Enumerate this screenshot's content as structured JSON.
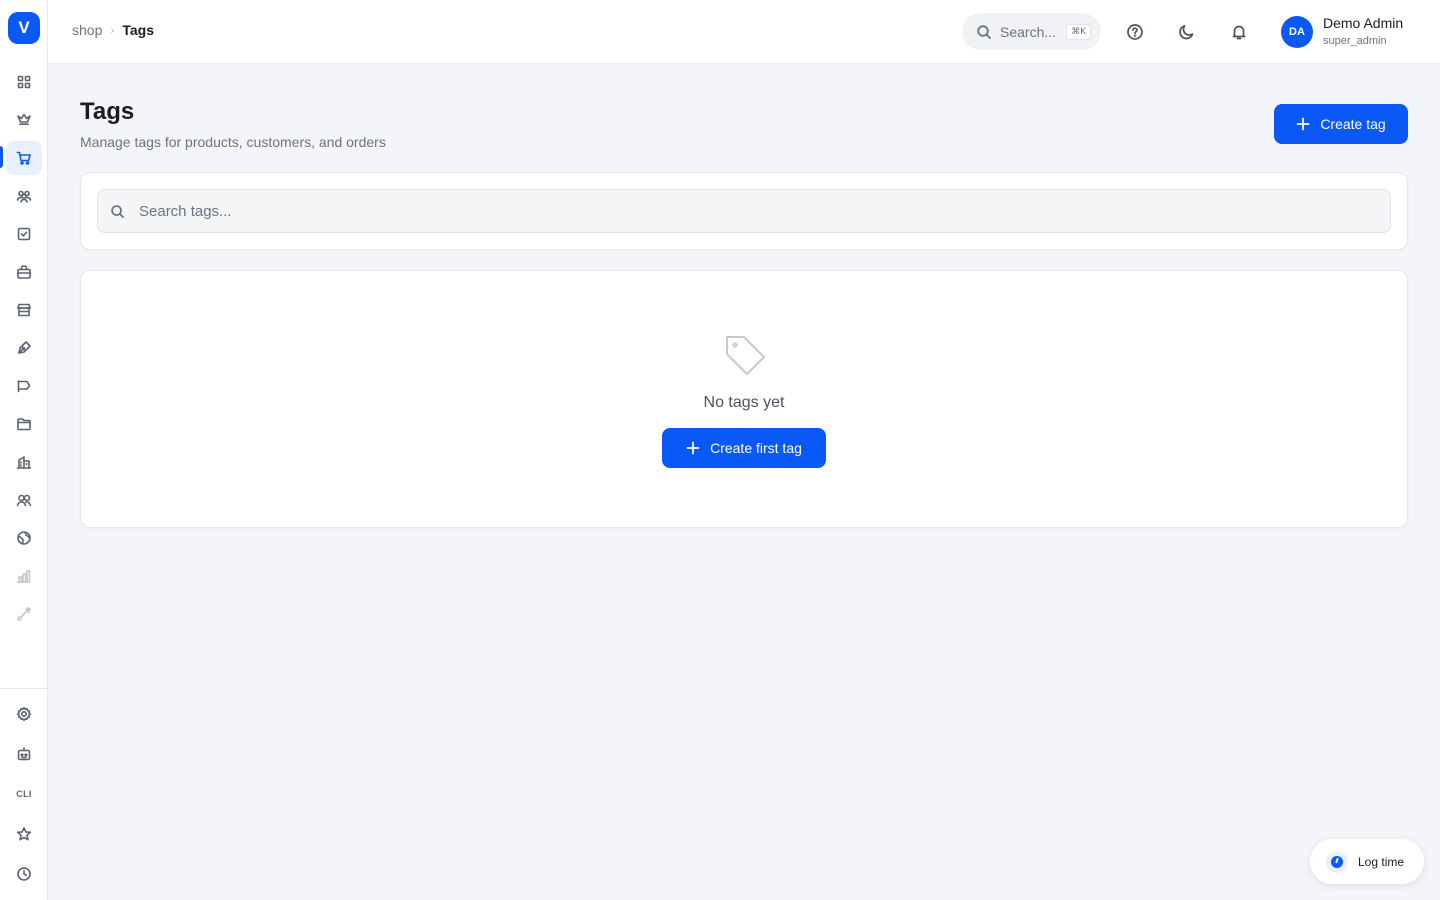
{
  "app": {
    "logo_letter": "V"
  },
  "breadcrumb": {
    "parent": "shop",
    "separator": "›",
    "current": "Tags"
  },
  "topbar": {
    "search_placeholder": "Search...",
    "search_shortcut": "⌘K",
    "user": {
      "initials": "DA",
      "name": "Demo Admin",
      "role": "super_admin"
    }
  },
  "sidebar": {
    "items": [
      {
        "name": "dashboard",
        "icon": "grid-icon"
      },
      {
        "name": "crown",
        "icon": "crown-icon"
      },
      {
        "name": "shop",
        "icon": "cart-icon",
        "active": true
      },
      {
        "name": "customers",
        "icon": "users-icon"
      },
      {
        "name": "tasks",
        "icon": "checkbox-icon"
      },
      {
        "name": "products",
        "icon": "bag-icon"
      },
      {
        "name": "store",
        "icon": "store-icon"
      },
      {
        "name": "design",
        "icon": "pen-icon"
      },
      {
        "name": "marketing",
        "icon": "megaphone-icon"
      },
      {
        "name": "files",
        "icon": "folder-icon"
      },
      {
        "name": "buildings",
        "icon": "building-icon"
      },
      {
        "name": "team",
        "icon": "team-icon"
      },
      {
        "name": "web",
        "icon": "globe-icon"
      },
      {
        "name": "analytics",
        "icon": "bar-chart-icon"
      },
      {
        "name": "integrations",
        "icon": "route-icon"
      }
    ],
    "bottom": [
      {
        "name": "settings",
        "icon": "gear-icon"
      },
      {
        "name": "bot",
        "icon": "robot-icon"
      },
      {
        "name": "cli",
        "label": "CLI"
      },
      {
        "name": "favorites",
        "icon": "star-icon"
      },
      {
        "name": "history",
        "icon": "clock-icon"
      }
    ]
  },
  "page": {
    "title": "Tags",
    "subtitle": "Manage tags for products, customers, and orders",
    "create_button": "Create tag"
  },
  "filter": {
    "search_placeholder": "Search tags..."
  },
  "empty_state": {
    "icon": "tag-icon",
    "message": "No tags yet",
    "button": "Create first tag"
  },
  "log_time": {
    "label": "Log time"
  },
  "colors": {
    "accent": "#0a59f6",
    "background": "#f4f5f8"
  }
}
